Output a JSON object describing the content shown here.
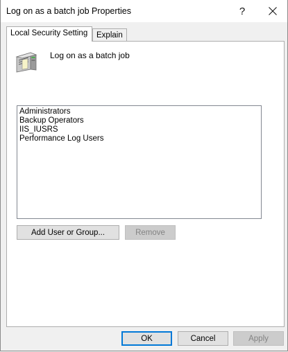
{
  "window": {
    "title": "Log on as a batch job Properties",
    "help_label": "?"
  },
  "tabs": [
    {
      "label": "Local Security Setting",
      "active": true
    },
    {
      "label": "Explain",
      "active": false
    }
  ],
  "policy": {
    "label": "Log on as a batch job",
    "icon": "server-policy-icon"
  },
  "members": [
    "Administrators",
    "Backup Operators",
    "IIS_IUSRS",
    "Performance Log Users"
  ],
  "buttons": {
    "add": "Add User or Group...",
    "remove": "Remove",
    "ok": "OK",
    "cancel": "Cancel",
    "apply": "Apply"
  },
  "colors": {
    "focus_border": "#0078d7",
    "dialog_bg": "#f0f0f0"
  }
}
